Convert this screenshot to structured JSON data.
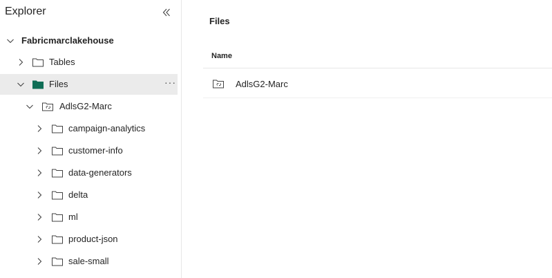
{
  "explorer": {
    "title": "Explorer",
    "collapse_icon": "double-chevron-left-icon",
    "tree": {
      "root": {
        "label": "Fabricmarclakehouse",
        "expanded": true
      },
      "tables": {
        "label": "Tables",
        "expanded": false
      },
      "files": {
        "label": "Files",
        "expanded": true,
        "selected": true,
        "more": "···"
      },
      "shortcut": {
        "label": "AdlsG2-Marc",
        "expanded": true
      },
      "folders": [
        {
          "label": "campaign-analytics"
        },
        {
          "label": "customer-info"
        },
        {
          "label": "data-generators"
        },
        {
          "label": "delta"
        },
        {
          "label": "ml"
        },
        {
          "label": "product-json"
        },
        {
          "label": "sale-small"
        }
      ]
    }
  },
  "files_pane": {
    "title": "Files",
    "column_name": "Name",
    "rows": [
      {
        "name": "AdlsG2-Marc",
        "icon": "shortcut-folder-icon"
      }
    ]
  },
  "colors": {
    "files_folder_fill": "#0f6e56",
    "selected_row_bg": "#ebebeb",
    "text": "#242424"
  }
}
